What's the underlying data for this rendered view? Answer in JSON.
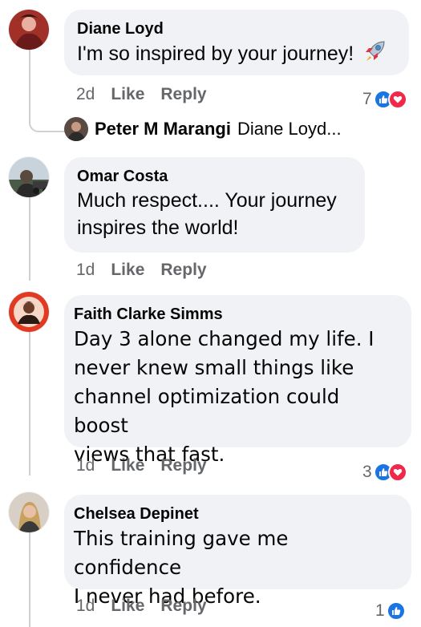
{
  "comments": [
    {
      "author": "Diane Loyd",
      "text": "I'm so inspired by your journey!",
      "emoji": "🚀",
      "age": "2d",
      "like_label": "Like",
      "reply_label": "Reply",
      "reaction_count": "7"
    },
    {
      "author": "Omar Costa",
      "text_line1": "Much respect.... Your journey",
      "text_line2": "inspires the world!",
      "age": "1d",
      "like_label": "Like",
      "reply_label": "Reply"
    },
    {
      "author": "Faith Clarke Simms",
      "text_line1": "Day 3 alone changed my life. I",
      "text_line2": "never knew small things like",
      "text_line3": "channel optimization could boost",
      "text_line4": "views that fast.",
      "age": "1d",
      "like_label": "Like",
      "reply_label": "Reply",
      "reaction_count": "3"
    },
    {
      "author": "Chelsea Depinet",
      "text_line1": "This training gave me confidence",
      "text_line2": "I never had before.",
      "age": "1d",
      "like_label": "Like",
      "reply_label": "Reply",
      "reaction_count": "1"
    }
  ],
  "reply_preview": {
    "author": "Peter M Marangi",
    "snippet": "Diane Loyd..."
  },
  "colors": {
    "bubble": "#f0f2f5",
    "meta": "#65676b",
    "like": "#1b74e4",
    "love": "#f0284a",
    "thread": "#ced0d4"
  },
  "icons": [
    "rocket-emoji-icon",
    "like-reaction-icon",
    "love-reaction-icon"
  ]
}
